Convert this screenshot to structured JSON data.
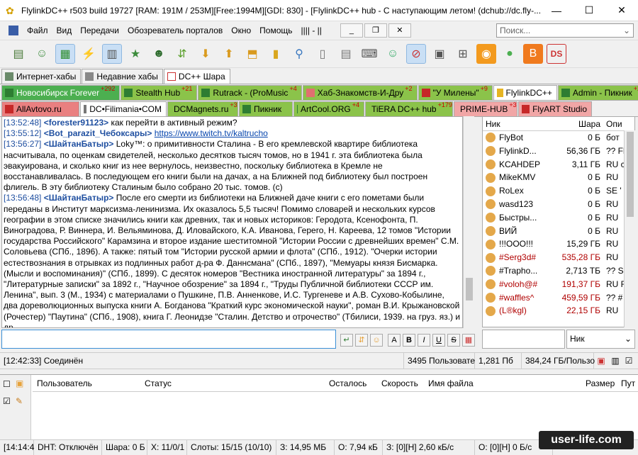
{
  "window": {
    "title": "FlylinkDC++ r503 build 19727 [RAM: 191M / 253M][Free:1994M][GDI: 830] - [FlylinkDC++ hub - С наступающим летом! (dchub://dc.fly-...",
    "min": "—",
    "max": "☐",
    "close": "✕"
  },
  "menu": {
    "items": [
      "Файл",
      "Вид",
      "Передачи",
      "Обозреватель порталов",
      "Окно",
      "Помощь"
    ],
    "extra": "||||  -  ||",
    "search_placeholder": "Поиск..."
  },
  "toolbar_icons": [
    "hub-list",
    "favorites",
    "users",
    "connect",
    "queue",
    "finished",
    "hash",
    "download",
    "upload",
    "upload-queue",
    "notepad",
    "search",
    "adl-search",
    "search-spy",
    "network",
    "ignored",
    "mute",
    "lan",
    "rss",
    "speed",
    "blog",
    "ds"
  ],
  "tabs_row1": [
    {
      "label": "Интернет-хабы"
    },
    {
      "label": "Недавние хабы"
    },
    {
      "label": "DC++ Шара"
    }
  ],
  "tabs_row2": [
    {
      "label": "Новосибирск Forever",
      "badge": "+292"
    },
    {
      "label": "Stealth Hub",
      "badge": "+21"
    },
    {
      "label": "Rutrack - (ProMusic",
      "badge": "+4"
    },
    {
      "label": "Хаб-Знакомств-И-Дру",
      "badge": "+2"
    },
    {
      "label": "\"У Милены\"",
      "badge": "+9"
    },
    {
      "label": "FlylinkDC++",
      "badge": ""
    },
    {
      "label": "Admin - Пикник",
      "badge": "+2"
    }
  ],
  "tabs_row3": [
    {
      "label": "AllAvtovo.ru",
      "badge": ""
    },
    {
      "label": "DC•Filimania•COM",
      "badge": ""
    },
    {
      "label": "DCMagnets.ru",
      "badge": "+3"
    },
    {
      "label": "Пикник",
      "badge": ""
    },
    {
      "label": "ArtCool.ORG",
      "badge": "+4"
    },
    {
      "label": "TiERA DC++ hub",
      "badge": "+179"
    },
    {
      "label": "PRIME-HUB",
      "badge": "+3"
    },
    {
      "label": "FlyART Studio",
      "badge": ""
    }
  ],
  "chat": [
    {
      "ts": "[13:52:48]",
      "nick": "<forester91123>",
      "text": " как перейти в активный режим?"
    },
    {
      "ts": "[13:55:12]",
      "nick": "<Bot_parazit_Чебоксары>",
      "text": " ",
      "link": "https://www.twitch.tv/kaltrucho"
    },
    {
      "ts": "[13:56:27]",
      "nick": "<ШайтанБатыр>",
      "text": " Loky™: о примитивности Сталина -  В его кремлевской квартире библиотека насчитывала, по оценкам свидетелей, несколько десятков тысяч томов, но в 1941 г. эта библиотека была эвакуирована, и сколько книг из нее вернулось, неизвестно, поскольку библиотека в Кремле не восстанавливалась. В последующем его книги были на дачах, а на Ближней под библиотеку был построен флигель. В эту библиотеку Сталиным было собрано 20 тыс. томов. (с)"
    },
    {
      "ts": "[13:56:48]",
      "nick": "<ШайтанБатыр>",
      "text": " После его смерти из библиотеки на Ближней даче книги с его пометами были переданы в Институт марксизма-ленинизма. Их оказалось 5,5 тысяч! Помимо словарей и нескольких курсов географии в этом списке значились книги как древних, так и новых историков: Геродота, Ксенофонта, П. Виноградова, Р. Виннера, И. Вельяминова, Д. Иловайского, К.А. Иванова, Герero, Н. Кареева, 12 томов \"Истории государства Российского\" Карамзина и второе издание шеститомной \"Истории России с древнейших времен\" С.М. Соловьева (СПб., 1896). А также: пятый том \"Истории русской армии и флота\" (СПб., 1912). \"Очерки истории естествознания в отрывках из подлинных работ д-ра Ф. Даннсмана\" (СПб., 1897), \"Мемуары князя Бисмарка. (Мысли и воспоминания)\" (СПб., 1899). С десяток номеров \"Вестника иностранной литературы\" за 1894 г., \"Литературные записки\" за 1892 г., \"Научное обозрение\" за 1894 г., \"Труды Публичной библиотеки СССР им. Ленина\", вып. 3 (М., 1934) с материалами о Пушкине, П.В. Анненкове, И.С. Тургеневе и А.В. Сухово-Кобылине, два дореволюционных выпуска книги А. Богданова \"Краткий курс экономической науки\", роман В.И. Крыжановской (Рочестер) \"Паутина\" (СПб., 1908), книга Г. Леонидзе \"Сталин. Детство и отрочество\" (Тбилиси, 1939. на груз. яз.) и др."
    }
  ],
  "userlist": {
    "headers": [
      "Ник",
      "Шара",
      "Опи"
    ],
    "rows": [
      {
        "nick": "FlyBot",
        "share": "0 Б",
        "desc": "бот",
        "color": "#000"
      },
      {
        "nick": "FlylinkD...",
        "share": "56,36 ГБ",
        "desc": "?? Fl",
        "color": "#000"
      },
      {
        "nick": "KCAHDEP",
        "share": "3,11 ГБ",
        "desc": "RU с",
        "color": "#000"
      },
      {
        "nick": "MikeKMV",
        "share": "0 Б",
        "desc": "RU",
        "color": "#000"
      },
      {
        "nick": "RoLex",
        "share": "0 Б",
        "desc": "SE '",
        "color": "#000"
      },
      {
        "nick": "wasd123",
        "share": "0 Б",
        "desc": "RU",
        "color": "#000"
      },
      {
        "nick": "Быстры...",
        "share": "0 Б",
        "desc": "RU",
        "color": "#000"
      },
      {
        "nick": "ВИЙ",
        "share": "0 Б",
        "desc": "RU",
        "color": "#000"
      },
      {
        "nick": "!!!ООО!!!",
        "share": "15,29 ГБ",
        "desc": "RU",
        "color": "#000"
      },
      {
        "nick": "#Serg3d#",
        "share": "535,28 ГБ",
        "desc": "RU",
        "color": "#b00000"
      },
      {
        "nick": "#Trapho...",
        "share": "2,713 ТБ",
        "desc": "?? Se",
        "color": "#000"
      },
      {
        "nick": "#voloh@#",
        "share": "191,37 ГБ",
        "desc": "RU R",
        "color": "#b00000"
      },
      {
        "nick": "#waffles^",
        "share": "459,59 ГБ",
        "desc": "?? #",
        "color": "#b00000"
      },
      {
        "nick": "(L®kgl)",
        "share": "22,15 ГБ",
        "desc": "RU",
        "color": "#b00000"
      }
    ]
  },
  "input": {
    "nick_select": "Ник"
  },
  "status": {
    "time": "[12:42:33] Соединён",
    "users": "3495 Пользовате",
    "share_pb": "1,281 Пб",
    "share_gb": "384,24 ГБ/Пользо"
  },
  "queue": {
    "headers": [
      "Пользователь",
      "Статус",
      "Осталось",
      "Скорость",
      "Имя файла",
      "Размер",
      "Пут"
    ]
  },
  "bottom": {
    "time": "[14:14:4",
    "dht": "DHT: Отключён",
    "share": "Шара: 0 Б",
    "hubs": "Х: 11/0/1",
    "slots": "Слоты: 15/15 (10/10)",
    "total": "З: 14,95 МБ",
    "up": "О: 7,94 кБ",
    "dl": "З: [0][Н] 2,60 кБ/с",
    "ul": "О: [0][Н] 0 Б/с"
  },
  "watermark": "user-life.com"
}
